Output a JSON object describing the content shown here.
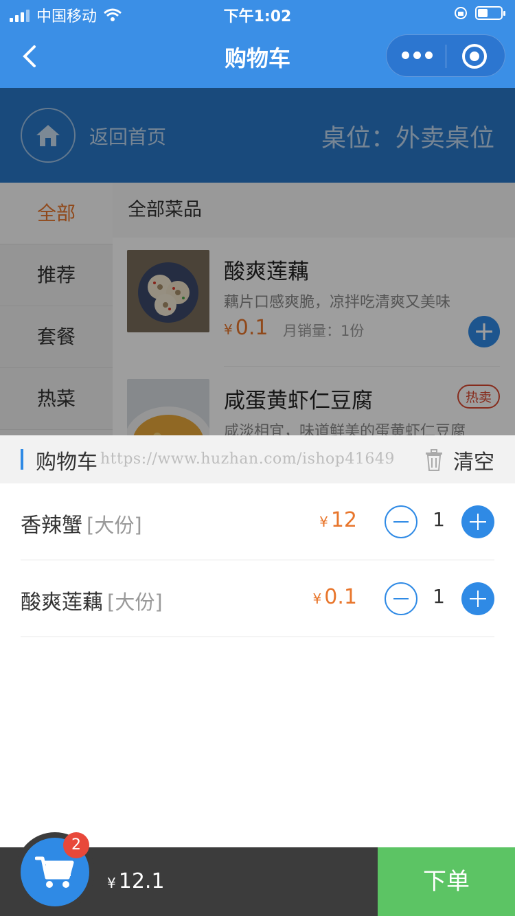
{
  "status_bar": {
    "carrier": "中国移动",
    "time": "下午1:02"
  },
  "nav": {
    "title": "购物车"
  },
  "header": {
    "home_label": "返回首页",
    "table_label": "桌位：外卖桌位"
  },
  "sidebar": {
    "items": [
      {
        "label": "全部",
        "active": true
      },
      {
        "label": "推荐"
      },
      {
        "label": "套餐"
      },
      {
        "label": "热菜"
      }
    ]
  },
  "menu": {
    "category_title": "全部菜品",
    "dishes": [
      {
        "name": "酸爽莲藕",
        "desc": "藕片口感爽脆，凉拌吃清爽又美味",
        "currency": "¥",
        "price": "0.1",
        "sales": "月销量：1份"
      },
      {
        "name": "咸蛋黄虾仁豆腐",
        "badge": "热卖",
        "desc": "咸淡相宜，味道鲜美的蛋黄虾仁豆腐"
      }
    ]
  },
  "cart": {
    "title": "购物车",
    "watermark": "https://www.huzhan.com/ishop41649",
    "clear_label": "清空",
    "items": [
      {
        "name": "香辣蟹",
        "spec": "[大份]",
        "currency": "¥",
        "price": "12",
        "qty": "1"
      },
      {
        "name": "酸爽莲藕",
        "spec": "[大份]",
        "currency": "¥",
        "price": "0.1",
        "qty": "1"
      }
    ]
  },
  "bottom": {
    "badge_count": "2",
    "currency": "¥",
    "total": "12.1",
    "order_label": "下单"
  },
  "colors": {
    "primary": "#3b8fe6",
    "accent": "#e8762c",
    "order_green": "#5cc464",
    "badge_red": "#e8483a"
  }
}
